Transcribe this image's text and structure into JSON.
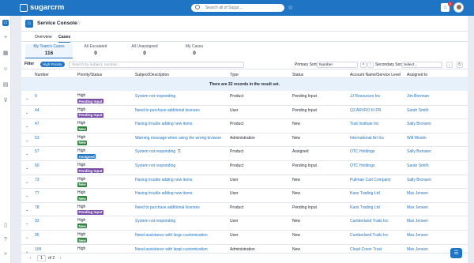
{
  "app": {
    "brand": "sugarcrm"
  },
  "topbar": {
    "search_placeholder": "Search all of Sugar...",
    "notif_count": "1"
  },
  "page": {
    "title": "Service Console"
  },
  "tabs": [
    {
      "label": "Overview"
    },
    {
      "label": "Cases"
    }
  ],
  "summaries": [
    {
      "label": "My Team's Cases",
      "value": "116"
    },
    {
      "label": "All Escalated",
      "value": "0"
    },
    {
      "label": "All Unassigned",
      "value": "0"
    },
    {
      "label": "My Cases",
      "value": "0"
    }
  ],
  "filter": {
    "label": "Filter",
    "chip": "High Priority",
    "search_placeholder": "Search by subject, number...",
    "primary_sort_label": "Primary Sort",
    "primary_sort_value": "Number",
    "secondary_sort_label": "Secondary Sort",
    "secondary_sort_value": "Select..."
  },
  "table": {
    "headers": [
      "Number",
      "Priority/Status",
      "Subject/Description",
      "Type",
      "Status",
      "Account Name/Service Level",
      "Assigned to"
    ],
    "notice": "There are 32 records in the result set.",
    "rows": [
      {
        "number": "9",
        "priority": "High",
        "badge": "Pending Input",
        "subject": "System not responding",
        "type": "Product",
        "status": "Pending Input",
        "account": "JJ Resources Inc",
        "assigned": "Jim Brennan"
      },
      {
        "number": "44",
        "priority": "High",
        "badge": "Pending Input",
        "subject": "Need to purchase additional licenses",
        "type": "User",
        "status": "Pending Input",
        "account": "Q3 ARVRO III PR",
        "assigned": "Sarah Smith"
      },
      {
        "number": "47",
        "priority": "High",
        "badge": "New",
        "subject": "Having trouble adding new items",
        "type": "Product",
        "status": "New",
        "account": "Trait Institute Inc",
        "assigned": "Sally Bronsen"
      },
      {
        "number": "53",
        "priority": "High",
        "badge": "New",
        "subject": "Warning message when using the wrong browser",
        "type": "Administration",
        "status": "New",
        "account": "International Art Inc",
        "assigned": "Will Westin"
      },
      {
        "number": "57",
        "priority": "High",
        "badge": "Assigned",
        "subject": "System not responding",
        "type": "Product",
        "status": "Assigned",
        "account": "OTC Holdings",
        "assigned": "Sally Bronsen"
      },
      {
        "number": "60",
        "priority": "High",
        "badge": "Pending Input",
        "subject": "System not responding",
        "type": "Product",
        "status": "Pending Input",
        "account": "OTC Holdings",
        "assigned": "Sarah Smith"
      },
      {
        "number": "73",
        "priority": "High",
        "badge": "New",
        "subject": "Having trouble adding new items",
        "type": "User",
        "status": "New",
        "account": "Pullman Cart Company",
        "assigned": "Sally Bronsen"
      },
      {
        "number": "77",
        "priority": "High",
        "badge": "New",
        "subject": "Having trouble adding new items",
        "type": "User",
        "status": "New",
        "account": "Kaos Trading Ltd",
        "assigned": "Max Jensen"
      },
      {
        "number": "78",
        "priority": "High",
        "badge": "Pending Input",
        "subject": "Need to purchase additional licenses",
        "type": "Product",
        "status": "Pending Input",
        "account": "Kaos Trading Ltd",
        "assigned": "Max Jensen"
      },
      {
        "number": "93",
        "priority": "High",
        "badge": "New",
        "subject": "System not responding",
        "type": "User",
        "status": "New",
        "account": "Cumberland Trails Inc",
        "assigned": "Max Jensen"
      },
      {
        "number": "95",
        "priority": "High",
        "badge": "New",
        "subject": "Need assistance with large customization",
        "type": "User",
        "status": "New",
        "account": "Cumberland Trails Inc",
        "assigned": "Max Jensen"
      },
      {
        "number": "109",
        "priority": "High",
        "badge": "",
        "subject": "Need assistance with large customization",
        "type": "Administration",
        "status": "New",
        "account": "Cloud Cover Trust",
        "assigned": "Max Jensen"
      }
    ]
  },
  "pager": {
    "page": "1",
    "of": "of 2"
  },
  "colors": {
    "pending": "#7a4ea8",
    "new": "#2e8540",
    "assigned": "#1f74c4"
  }
}
